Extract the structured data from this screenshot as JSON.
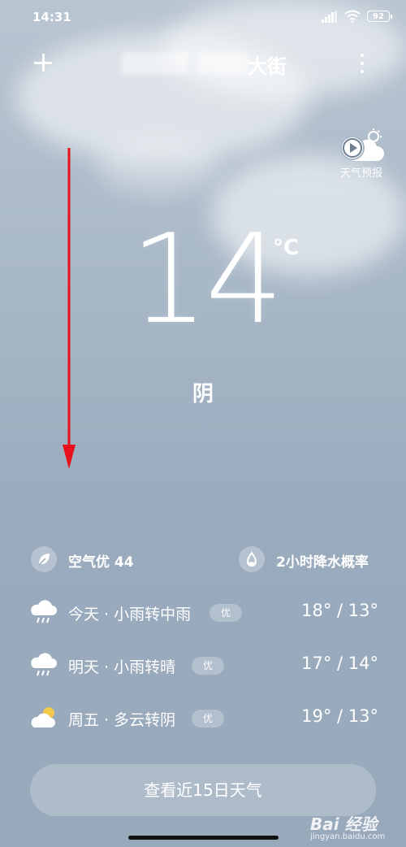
{
  "status_bar": {
    "time": "14:31",
    "battery": "92"
  },
  "header": {
    "title_suffix": "大街"
  },
  "forecast_video": {
    "label": "天气预报"
  },
  "current": {
    "temperature": "14",
    "unit": "°C",
    "condition": "阴"
  },
  "info": {
    "air_quality": "空气优 44",
    "precipitation": "2小时降水概率"
  },
  "days": [
    {
      "label": "今天 · 小雨转中雨",
      "aq": "优",
      "temps": "18° / 13°",
      "icon": "rain-cloud-icon"
    },
    {
      "label": "明天 · 小雨转晴",
      "aq": "优",
      "temps": "17° / 14°",
      "icon": "rain-cloud-icon"
    },
    {
      "label": "周五 · 多云转阴",
      "aq": "优",
      "temps": "19° / 13°",
      "icon": "partly-cloudy-icon"
    }
  ],
  "cta": {
    "label": "查看近15日天气"
  },
  "watermark": {
    "brand": "Bai 经验",
    "url": "jingyan.baidu.com"
  },
  "colors": {
    "annotation_arrow": "#e8101a",
    "background_top": "#b9c5d1",
    "background_bottom": "#98a9bc"
  }
}
